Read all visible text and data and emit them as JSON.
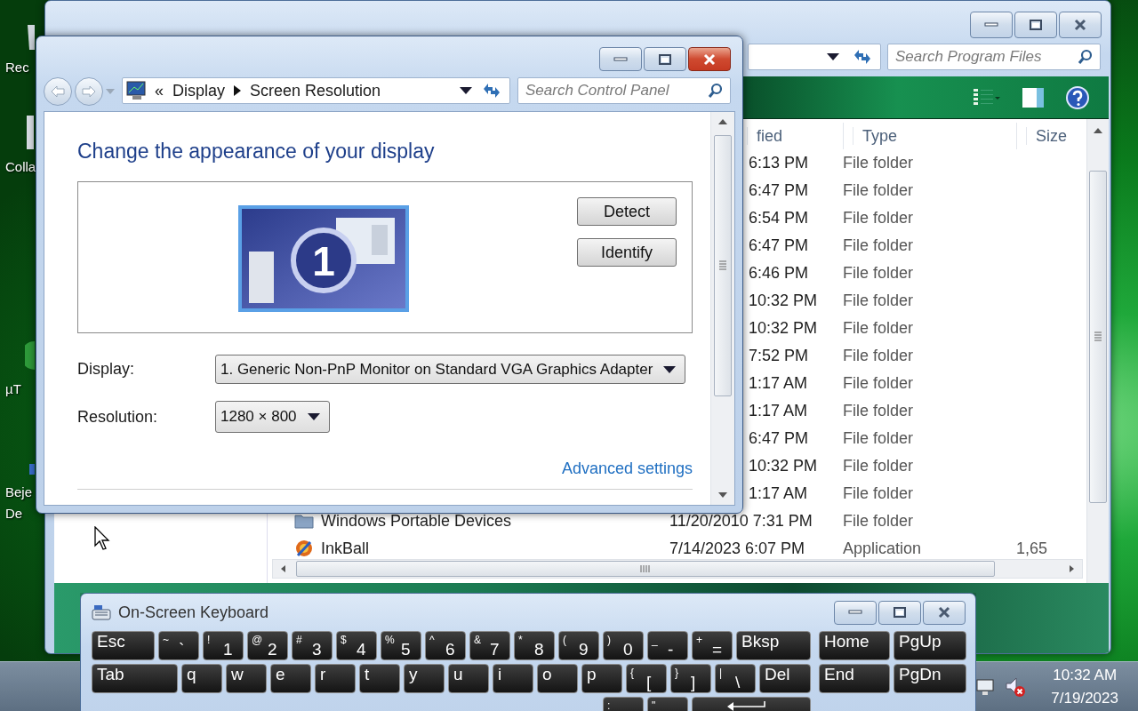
{
  "desktop_icons": [
    {
      "lines": [
        "Rec"
      ]
    },
    {
      "lines": [
        "Colla"
      ]
    },
    {
      "lines": [
        "µT"
      ]
    },
    {
      "lines": [
        "Beje",
        "De"
      ]
    }
  ],
  "explorer": {
    "search_placeholder": "Search Program Files",
    "columns": [
      "fied",
      "Type",
      "Size"
    ],
    "rows": [
      {
        "kind": "time_only",
        "date": "6:13 PM",
        "type": "File folder"
      },
      {
        "kind": "time_only",
        "date": "6:47 PM",
        "type": "File folder"
      },
      {
        "kind": "time_only",
        "date": "6:54 PM",
        "type": "File folder"
      },
      {
        "kind": "time_only",
        "date": "6:47 PM",
        "type": "File folder"
      },
      {
        "kind": "time_only",
        "date": "6:46 PM",
        "type": "File folder"
      },
      {
        "kind": "time_only",
        "date": "10:32 PM",
        "type": "File folder"
      },
      {
        "kind": "time_only",
        "date": "10:32 PM",
        "type": "File folder"
      },
      {
        "kind": "time_only",
        "date": "7:52 PM",
        "type": "File folder"
      },
      {
        "kind": "time_only",
        "date": "1:17 AM",
        "type": "File folder"
      },
      {
        "kind": "time_only",
        "date": "1:17 AM",
        "type": "File folder"
      },
      {
        "kind": "time_only",
        "date": "6:47 PM",
        "type": "File folder"
      },
      {
        "kind": "time_only",
        "date": "10:32 PM",
        "type": "File folder"
      },
      {
        "kind": "time_only",
        "date": "1:17 AM",
        "type": "File folder"
      },
      {
        "kind": "folder",
        "name": "Windows Portable Devices",
        "date": "11/20/2010 7:31 PM",
        "type": "File folder"
      },
      {
        "kind": "application",
        "name": "InkBall",
        "date": "7/14/2023 6:07 PM",
        "type": "Application",
        "size": "1,65"
      }
    ]
  },
  "control_panel": {
    "overflow": "«",
    "breadcrumb": [
      "Display",
      "Screen Resolution"
    ],
    "search_placeholder": "Search Control Panel",
    "heading": "Change the appearance of your display",
    "monitor_number": "1",
    "buttons": [
      "Detect",
      "Identify"
    ],
    "fields": [
      {
        "label": "Display:",
        "value": "1. Generic Non-PnP Monitor on Standard VGA Graphics Adapter"
      },
      {
        "label": "Resolution:",
        "value": "1280 × 800"
      }
    ],
    "link": "Advanced settings"
  },
  "keyboard": {
    "title": "On-Screen Keyboard",
    "rows": [
      {
        "enter_key": false,
        "keys": [
          {
            "label": "Esc"
          },
          {
            "shift": "~",
            "label": "`"
          },
          {
            "shift": "!",
            "label": "1"
          },
          {
            "shift": "@",
            "label": "2"
          },
          {
            "shift": "#",
            "label": "3"
          },
          {
            "shift": "$",
            "label": "4"
          },
          {
            "shift": "%",
            "label": "5"
          },
          {
            "shift": "^",
            "label": "6"
          },
          {
            "shift": "&",
            "label": "7"
          },
          {
            "shift": "*",
            "label": "8"
          },
          {
            "shift": "(",
            "label": "9"
          },
          {
            "shift": ")",
            "label": "0"
          },
          {
            "shift": "_",
            "label": "-"
          },
          {
            "shift": "+",
            "label": "="
          },
          {
            "label": "Bksp"
          }
        ],
        "nav": [
          {
            "label": "Home"
          },
          {
            "label": "PgUp"
          }
        ]
      },
      {
        "enter_key": false,
        "keys": [
          {
            "label": "Tab"
          },
          {
            "label": "q"
          },
          {
            "label": "w"
          },
          {
            "label": "e"
          },
          {
            "label": "r"
          },
          {
            "label": "t"
          },
          {
            "label": "y"
          },
          {
            "label": "u"
          },
          {
            "label": "i"
          },
          {
            "label": "o"
          },
          {
            "label": "p"
          },
          {
            "shift": "{",
            "label": "["
          },
          {
            "shift": "}",
            "label": "]"
          },
          {
            "shift": "|",
            "label": "\\"
          },
          {
            "label": "Del"
          }
        ],
        "nav": [
          {
            "label": "End"
          },
          {
            "label": "PgDn"
          }
        ]
      },
      {
        "enter_key": true,
        "keys": [
          {
            "shift": ":"
          },
          {
            "shift": "\""
          }
        ]
      }
    ]
  },
  "taskbar": {
    "time": "10:32 AM",
    "date": "7/19/2023"
  }
}
